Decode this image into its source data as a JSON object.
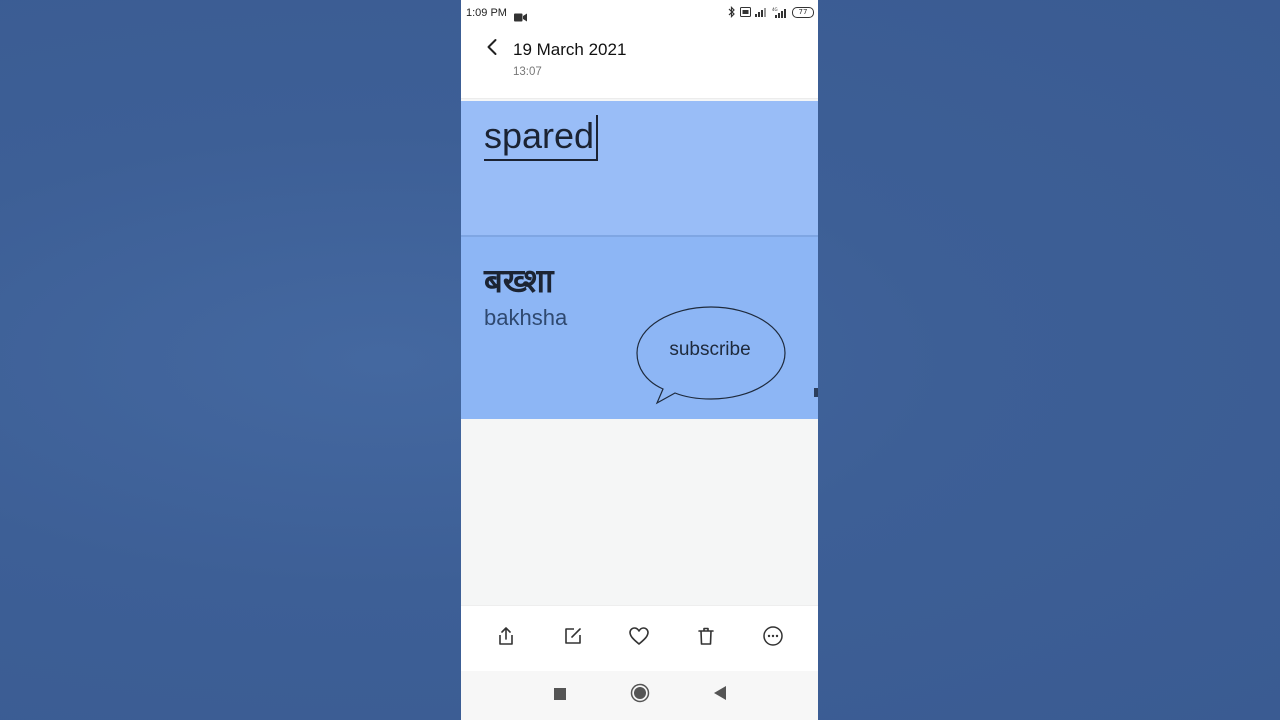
{
  "status_bar": {
    "time": "1:09 PM",
    "battery": "77",
    "icons": [
      "video-camera-icon",
      "bluetooth-icon",
      "volte-icon",
      "signal-icon",
      "signal-4g-icon",
      "battery-icon"
    ]
  },
  "header": {
    "title": "19 March 2021",
    "subtitle": "13:07",
    "back_icon": "chevron-left-icon"
  },
  "content": {
    "word_english": "spared",
    "word_hindi": "बख्शा",
    "transliteration": "bakhsha",
    "bubble_text": "subscribe",
    "colors": {
      "card_top": "#99bdf7",
      "card_bottom": "#8db6f5",
      "background": "#3e6097"
    }
  },
  "toolbar": {
    "items": [
      {
        "icon": "share-icon"
      },
      {
        "icon": "edit-icon"
      },
      {
        "icon": "heart-icon"
      },
      {
        "icon": "trash-icon"
      },
      {
        "icon": "more-icon"
      }
    ]
  },
  "nav_bar": {
    "items": [
      {
        "icon": "recents-square-icon"
      },
      {
        "icon": "home-circle-icon"
      },
      {
        "icon": "back-triangle-icon"
      }
    ]
  }
}
